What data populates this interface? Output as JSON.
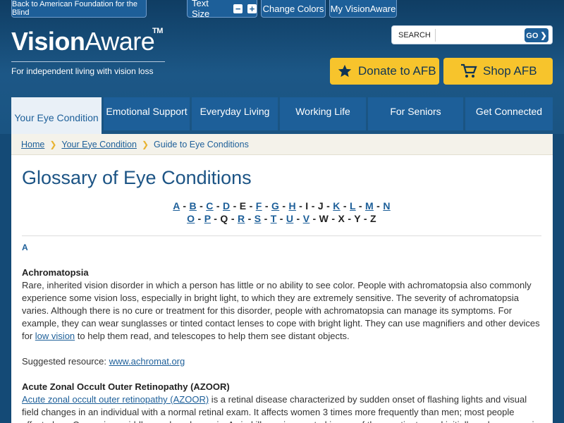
{
  "topbar": {
    "back_label": "Back to American Foundation for the Blind",
    "text_size_label": "Text Size",
    "decrease_symbol": "−",
    "increase_symbol": "+",
    "change_colors_label": "Change Colors",
    "my_visionaware_label": "My VisionAware"
  },
  "brand": {
    "logo_bold": "Vision",
    "logo_light": "Aware",
    "trademark": "TM",
    "tagline": "For independent living with vision loss"
  },
  "search": {
    "label": "SEARCH",
    "placeholder": "",
    "go_label": "GO ❯"
  },
  "cta": {
    "donate_label": "Donate to AFB",
    "shop_label": "Shop AFB"
  },
  "nav": {
    "items": [
      {
        "label": "Your Eye Condition",
        "active": true
      },
      {
        "label": "Emotional Support",
        "active": false
      },
      {
        "label": "Everyday Living",
        "active": false
      },
      {
        "label": "Working Life",
        "active": false
      },
      {
        "label": "For Seniors",
        "active": false
      },
      {
        "label": "Get Connected",
        "active": false
      }
    ]
  },
  "breadcrumb": {
    "home": "Home",
    "section": "Your Eye Condition",
    "current": "Guide to Eye Conditions"
  },
  "page": {
    "title": "Glossary of Eye Conditions"
  },
  "alphabet": {
    "row1": [
      {
        "l": "A",
        "link": true
      },
      {
        "l": "B",
        "link": true
      },
      {
        "l": "C",
        "link": true
      },
      {
        "l": "D",
        "link": true
      },
      {
        "l": "E",
        "link": false
      },
      {
        "l": "F",
        "link": true
      },
      {
        "l": "G",
        "link": true
      },
      {
        "l": "H",
        "link": true
      },
      {
        "l": "I",
        "link": false
      },
      {
        "l": "J",
        "link": false
      },
      {
        "l": "K",
        "link": true
      },
      {
        "l": "L",
        "link": true
      },
      {
        "l": "M",
        "link": true
      },
      {
        "l": "N",
        "link": true
      }
    ],
    "row2": [
      {
        "l": "O",
        "link": true
      },
      {
        "l": "P",
        "link": true
      },
      {
        "l": "Q",
        "link": false
      },
      {
        "l": "R",
        "link": true
      },
      {
        "l": "S",
        "link": true
      },
      {
        "l": "T",
        "link": true
      },
      {
        "l": "U",
        "link": true
      },
      {
        "l": "V",
        "link": true
      },
      {
        "l": "W",
        "link": false
      },
      {
        "l": "X",
        "link": false
      },
      {
        "l": "Y",
        "link": false
      },
      {
        "l": "Z",
        "link": false
      }
    ]
  },
  "glossary": {
    "section_letter": "A",
    "entry1": {
      "term": "Achromatopsia",
      "text_before": "Rare, inherited vision disorder in which a person has little or no ability to see color. People with achromatopsia also commonly experience some vision loss, especially in bright light, to which they are extremely sensitive. The severity of achromatopsia varies. Although there is no cure or treatment for this disorder, people with achromatopsia can manage its symptoms. For example, they can wear sunglasses or tinted contact lenses to cope with bright light. They can use magnifiers and other devices for ",
      "link_text": "low vision",
      "text_after": " to help them read, and telescopes to help them see distant objects.",
      "resource_label": "Suggested resource: ",
      "resource_link": "www.achromat.org"
    },
    "entry2": {
      "term": "Acute Zonal Occult Outer Retinopathy (AZOOR)",
      "link_text": "Acute zonal occult outer retinopathy (AZOOR)",
      "text": " is a retinal disease characterized by sudden onset of flashing lights and visual field changes in an individual with a normal retinal exam. It affects women 3 times more frequently than men; most people affected are Caucasian, middle-aged, and myopic. A viral illness is reported in one of three patients, and initially, only one eye is involved but then the"
    }
  }
}
